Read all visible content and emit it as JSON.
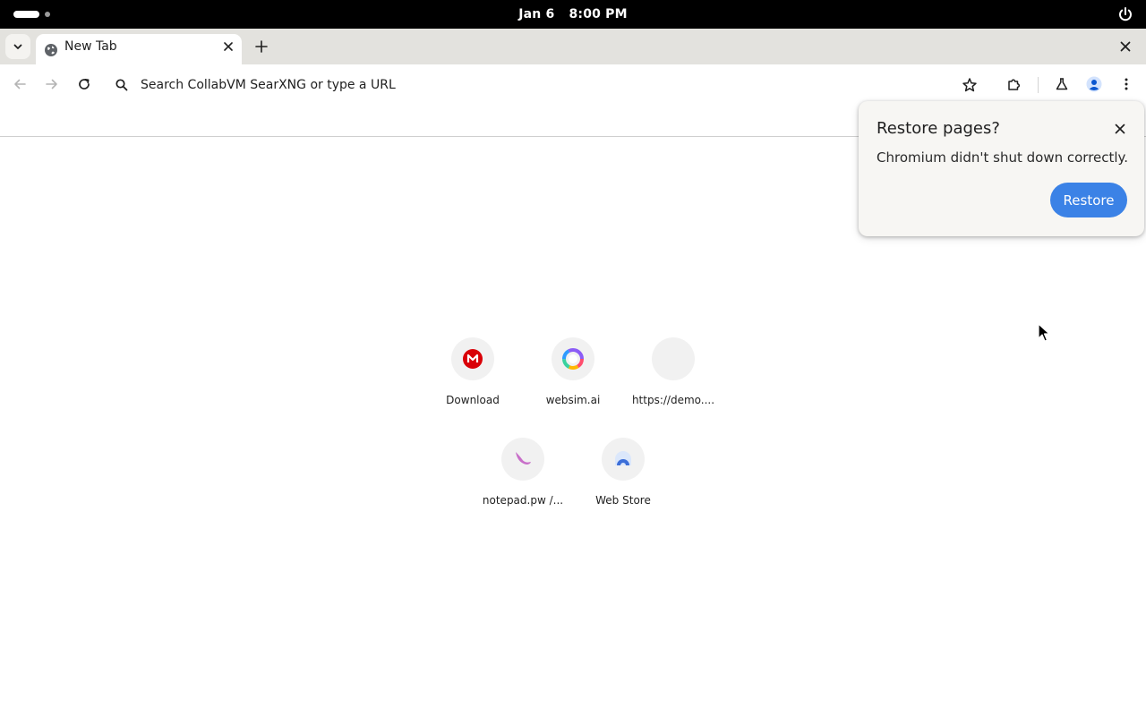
{
  "system_bar": {
    "date": "Jan 6",
    "time": "8:00 PM",
    "icons": {
      "activities": "activities-indicator",
      "power": "power-icon"
    }
  },
  "browser": {
    "tab": {
      "title": "New Tab",
      "favicon": "globe-icon"
    },
    "omnibox": {
      "placeholder": "Search CollabVM SearXNG or type a URL"
    },
    "toolbar_icons": [
      "back-arrow-icon",
      "forward-arrow-icon",
      "reload-icon",
      "star-icon",
      "extensions-icon",
      "labs-flask-icon",
      "profile-icon",
      "kebab-menu-icon"
    ]
  },
  "new_tab_page": {
    "shortcuts": [
      {
        "label": "Download",
        "icon": "mega-icon",
        "color": "#d90007"
      },
      {
        "label": "websim.ai",
        "icon": "websim-icon",
        "color": "#7a5cff"
      },
      {
        "label": "https://demo....",
        "icon": "blank-site-icon",
        "color": "#f1f1f1"
      },
      {
        "label": "notepad.pw /...",
        "icon": "notepad-icon",
        "color": "#c86fc9"
      },
      {
        "label": "Web Store",
        "icon": "web-store-icon",
        "color": "#3d6fd8"
      }
    ]
  },
  "restore_bubble": {
    "title": "Restore pages?",
    "message": "Chromium didn't shut down correctly.",
    "button": "Restore",
    "accent": "#3b82e6"
  }
}
